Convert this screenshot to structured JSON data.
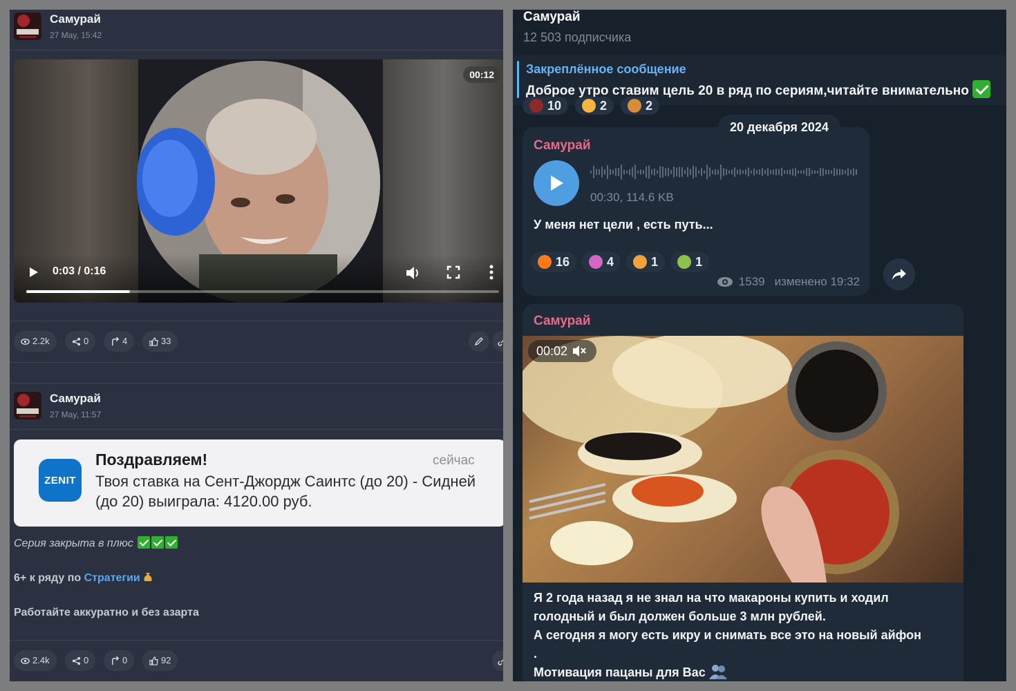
{
  "left": {
    "post1": {
      "channel": "Самурай",
      "date": "27 May, 15:42",
      "video": {
        "duration_badge": "00:12",
        "clock": "0:03 / 0:16",
        "progress": 0.22
      },
      "stats": {
        "views": "2.2k",
        "shares": "0",
        "reposts": "4",
        "likes": "33"
      }
    },
    "post2": {
      "channel": "Самурай",
      "date": "27 May, 11:57",
      "notification": {
        "logo": "ZENIT",
        "title": "Поздравляем!",
        "time": "сейчас",
        "body": "Твоя ставка на Сент-Джордж Саинтс (до 20) - Сидней (до 20) выиграла: 4120.00 руб."
      },
      "line1": "Серия закрыта в плюс",
      "line2_prefix": "6+ к ряду по ",
      "line2_link": "Стратегии",
      "line3": "Работайте аккуратно и без азарта",
      "stats": {
        "views": "2.4k",
        "shares": "0",
        "reposts": "0",
        "likes": "92"
      }
    }
  },
  "right": {
    "channel_title": "Самурай",
    "subscribers": "12 503 подписчика",
    "pinned": {
      "label": "Закреплённое сообщение",
      "text": "Доброе утро ставим цель 20 в ряд по сериям,читайте внимательно"
    },
    "top_reactions": [
      {
        "count": "10",
        "color": "#8b2a2a"
      },
      {
        "count": "2",
        "color": "#f4b63f"
      },
      {
        "count": "2",
        "color": "#d98c3c"
      }
    ],
    "date_pill": "20 декабря 2024",
    "voice_msg": {
      "author": "Самурай",
      "meta": "00:30, 114.6 KB",
      "text": "У меня нет цели , есть путь...",
      "reactions": [
        {
          "count": "16",
          "color": "#ff7a1a",
          "icon": "fire-emoji"
        },
        {
          "count": "4",
          "color": "#d567c4",
          "icon": "person-emoji"
        },
        {
          "count": "1",
          "color": "#f1a33c",
          "icon": "party-popper-emoji"
        },
        {
          "count": "1",
          "color": "#8fc24a",
          "icon": "champagne-emoji"
        }
      ],
      "views": "1539",
      "edited": "изменено 19:32"
    },
    "video_msg": {
      "author": "Самурай",
      "badge": "00:02",
      "text_lines": [
        "Я 2 года назад я не знал на что макароны купить и ходил",
        "голодный  и был должен больше 3 млн рублей.",
        "А сегодня я могу есть икру и снимать все это на новый айфон",
        ".",
        "Мотивация пацаны для Вас"
      ]
    }
  }
}
